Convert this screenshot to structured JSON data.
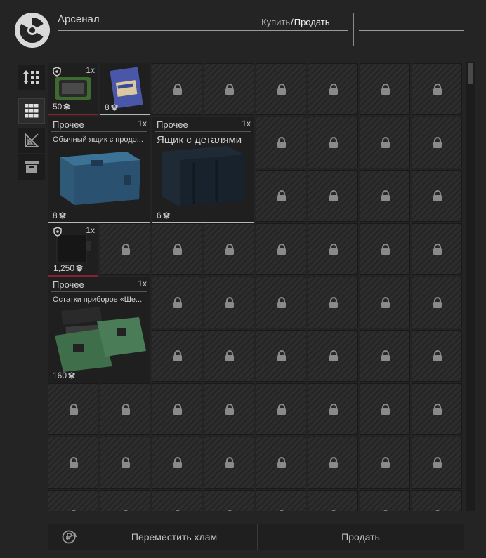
{
  "header": {
    "title": "Арсенал",
    "buy_label": "Купить",
    "separator": "/",
    "sell_label": "Продать"
  },
  "sidebar": {
    "buttons": [
      {
        "icon": "sort-icon"
      },
      {
        "icon": "grid-view-icon",
        "active": true
      },
      {
        "icon": "ruler-triangle-icon"
      },
      {
        "icon": "archive-box-icon"
      }
    ]
  },
  "items": [
    {
      "count": "1x",
      "amount": "50",
      "icon": "rig-item-icon"
    },
    {
      "count": "",
      "amount": "8",
      "icon": "ration-pack-icon"
    },
    {
      "category": "Прочее",
      "count": "1x",
      "name": "Обычный ящик с продо...",
      "amount": "8",
      "icon": "blue-crate-icon"
    },
    {
      "category": "Прочее",
      "count": "1x",
      "name": "Ящик с деталями",
      "amount": "6",
      "icon": "dark-crate-icon"
    },
    {
      "count": "1x",
      "amount": "1,250",
      "icon": "black-case-icon"
    },
    {
      "category": "Прочее",
      "count": "1x",
      "name": "Остатки приборов «Ше...",
      "amount": "160",
      "icon": "circuit-boards-icon"
    }
  ],
  "footer": {
    "move_junk_label": "Переместить хлам",
    "sell_label": "Продать"
  },
  "colors": {
    "background": "#242424",
    "cell": "#2d2d2d",
    "rarity_red": "#8a2030"
  }
}
